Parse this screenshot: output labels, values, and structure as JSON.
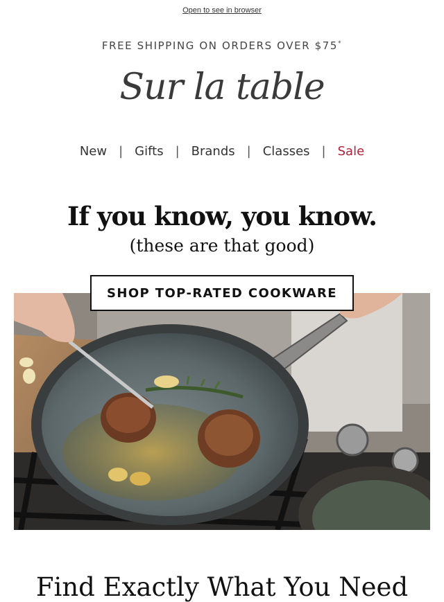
{
  "header": {
    "browser_link": "Open to see in browser",
    "shipping": "FREE SHIPPING ON ORDERS OVER $75",
    "shipping_mark": "*",
    "logo": "Sur la table"
  },
  "nav": {
    "items": [
      "New",
      "Gifts",
      "Brands",
      "Classes",
      "Sale"
    ],
    "separator": "|",
    "sale_color": "#b0233b"
  },
  "hero": {
    "headline": "If you know, you know.",
    "subhead": "(these are that good)",
    "cta": "SHOP TOP-RATED COOKWARE",
    "image": "Steaks searing in a gray ceramic nonstick skillet with rosemary and garlic on a gas stove"
  },
  "section": {
    "title": "Find Exactly What You Need"
  }
}
